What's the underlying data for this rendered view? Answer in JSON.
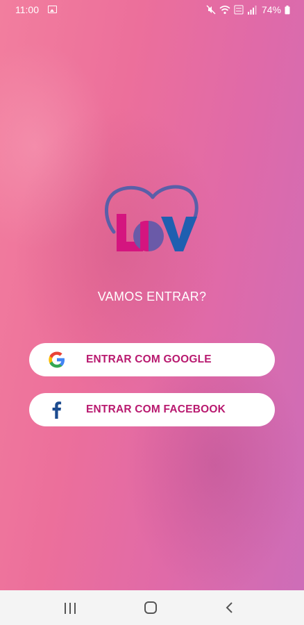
{
  "status_bar": {
    "time": "11:00",
    "battery": "74%",
    "icons": [
      "gallery-icon",
      "mute-icon",
      "wifi-icon",
      "volte-icon",
      "signal-icon",
      "battery-icon"
    ]
  },
  "logo": {
    "text": "LOV"
  },
  "prompt": "VAMOS ENTRAR?",
  "buttons": {
    "google": {
      "label": "ENTRAR COM GOOGLE",
      "icon": "google-icon"
    },
    "facebook": {
      "label": "ENTRAR COM FACEBOOK",
      "icon": "facebook-icon"
    }
  },
  "nav_bar": {
    "icons": [
      "recents-icon",
      "home-icon",
      "back-icon"
    ]
  },
  "colors": {
    "button_text": "#b8196f",
    "logo_heart": "#5a5fa8",
    "logo_l": "#d4157f",
    "logo_v": "#1f5fb0"
  }
}
